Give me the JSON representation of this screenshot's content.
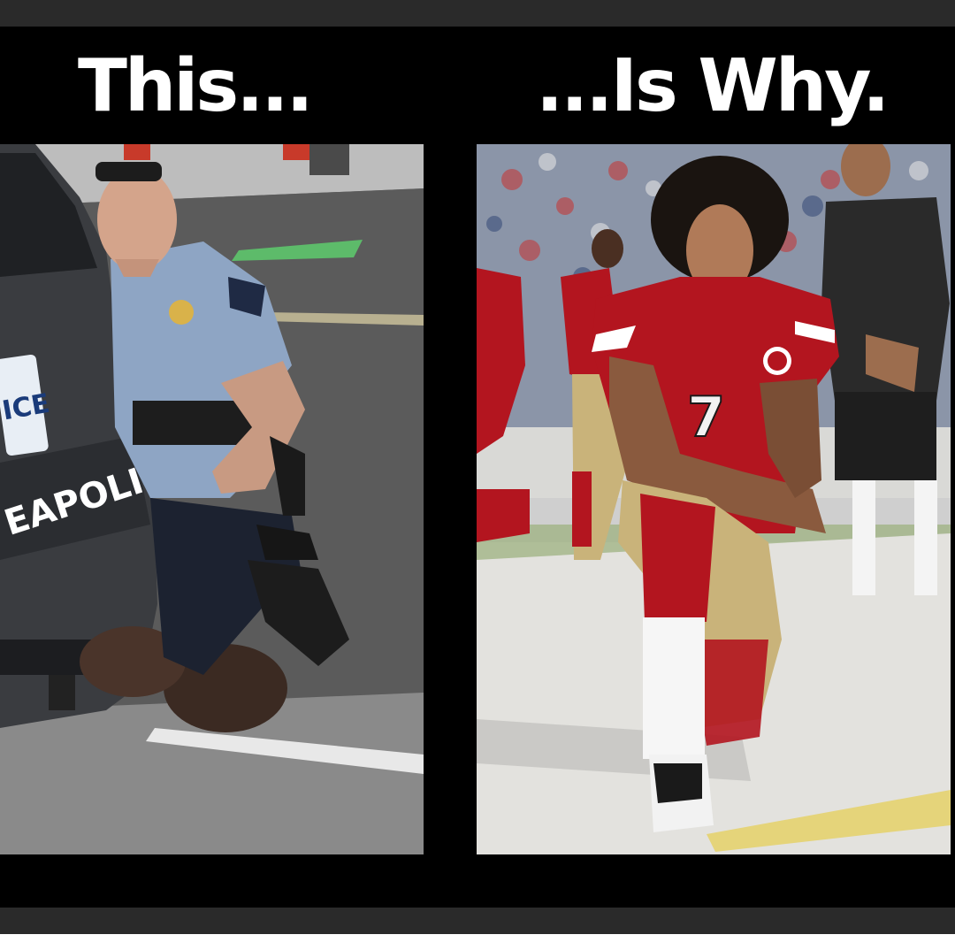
{
  "meme": {
    "left_caption": "This...",
    "right_caption": "...Is Why."
  },
  "left_photo": {
    "vehicle_text": "EAPOLIS",
    "plate_text": "ICE"
  },
  "right_photo": {
    "jersey_number": "7"
  },
  "colors": {
    "background": "#000000",
    "caption": "#ffffff",
    "jersey_red": "#b3151f",
    "pants_gold": "#c9b37a",
    "police_blue": "#8ea5c4"
  }
}
